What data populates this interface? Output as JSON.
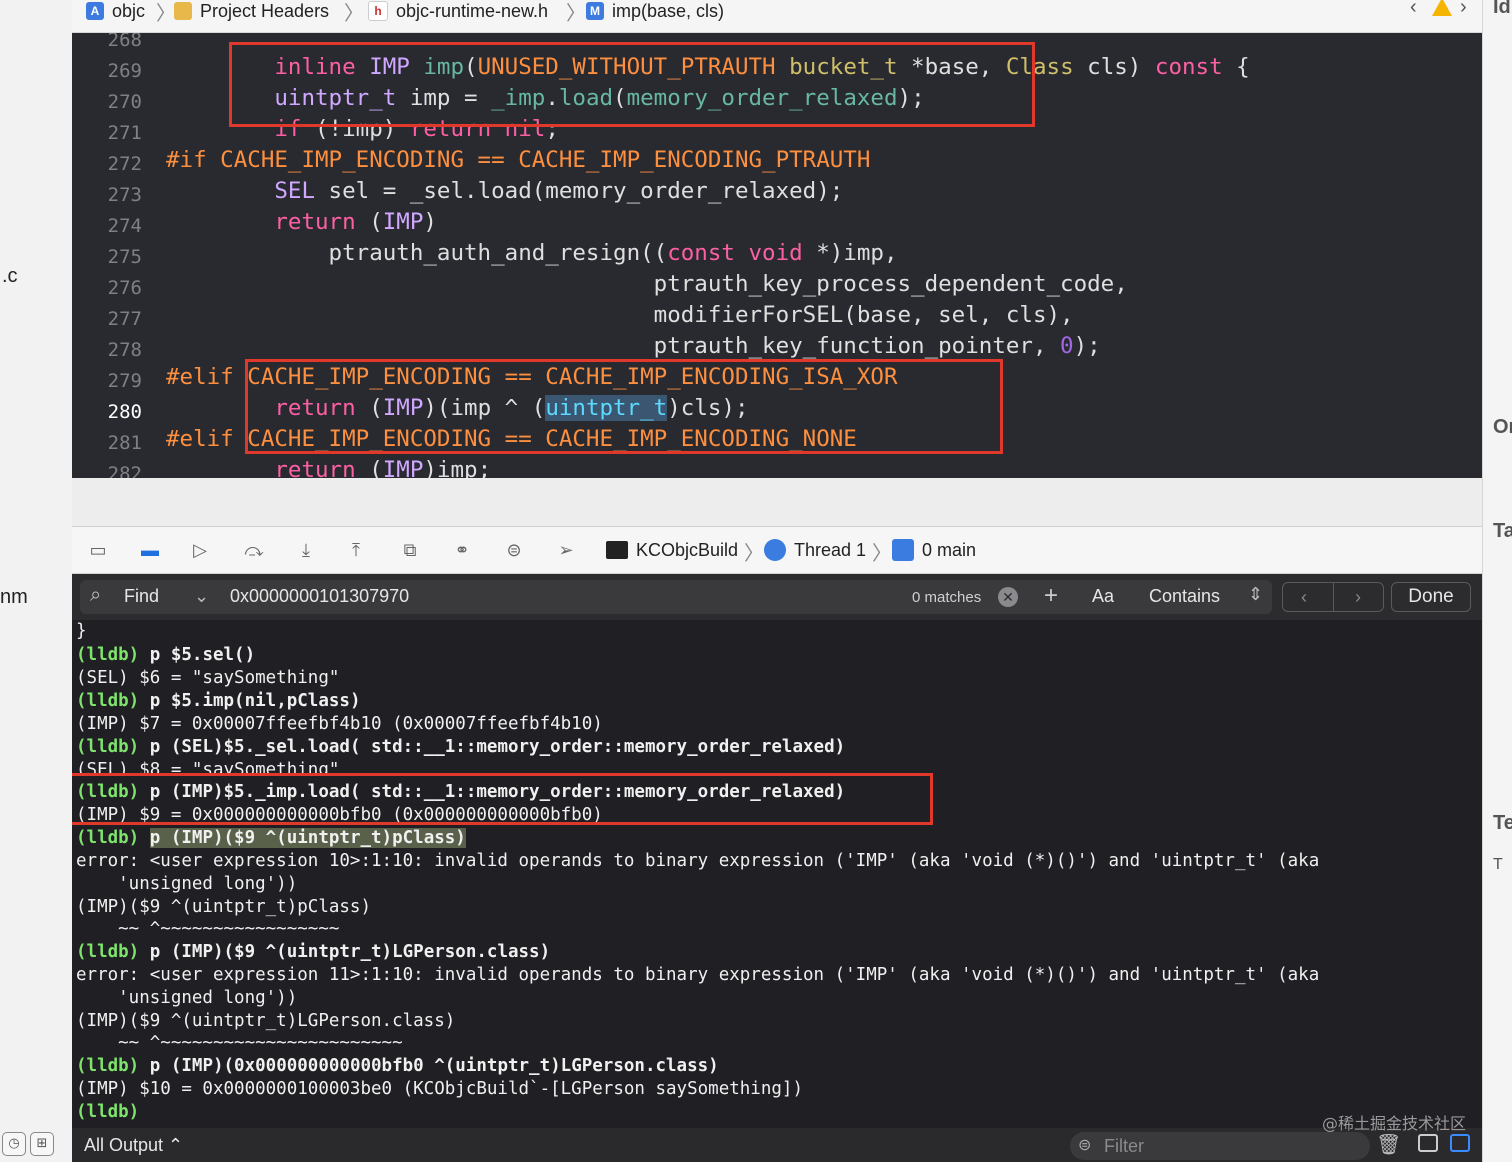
{
  "sidebar_fragments": [
    ".c",
    "nm"
  ],
  "inspector_fragments": [
    "Id",
    "Or",
    "Ta",
    "Te",
    "T"
  ],
  "breadcrumb": {
    "items": [
      {
        "label": "objc",
        "icon": "project-icon"
      },
      {
        "label": "Project Headers",
        "icon": "folder-icon"
      },
      {
        "label": "objc-runtime-new.h",
        "icon": "header-file-icon"
      },
      {
        "label": "imp(base, cls)",
        "icon": "method-icon"
      }
    ]
  },
  "editor": {
    "line_numbers": [
      "268",
      "269",
      "270",
      "271",
      "272",
      "273",
      "274",
      "275",
      "276",
      "277",
      "278",
      "279",
      "280",
      "281",
      "282"
    ],
    "current_line": "280"
  },
  "debug_bar": {
    "target": "KCObjcBuild",
    "thread": "Thread 1",
    "frame": "0 main"
  },
  "find_bar": {
    "mode": "Find",
    "query": "0x0000000101307970",
    "matches": "0 matches",
    "case_label": "Aa",
    "match_mode": "Contains",
    "done_label": "Done"
  },
  "console_lines": [
    "}",
    "(lldb) p $5.sel()",
    "(SEL) $6 = \"saySomething\"",
    "(lldb) p $5.imp(nil,pClass)",
    "(IMP) $7 = 0x00007ffeefbf4b10 (0x00007ffeefbf4b10)",
    "(lldb) p (SEL)$5._sel.load( std::__1::memory_order::memory_order_relaxed)",
    "(SEL) $8 = \"saySomething\"",
    "(lldb) p (IMP)$5._imp.load( std::__1::memory_order::memory_order_relaxed)",
    "(IMP) $9 = 0x000000000000bfb0 (0x000000000000bfb0)",
    "(lldb) p (IMP)($9 ^(uintptr_t)pClass)",
    "error: <user expression 10>:1:10: invalid operands to binary expression ('IMP' (aka 'void (*)()') and 'uintptr_t' (aka",
    "    'unsigned long'))",
    "(IMP)($9 ^(uintptr_t)pClass)",
    "    ~~ ^~~~~~~~~~~~~~~~~~",
    "(lldb) p (IMP)($9 ^(uintptr_t)LGPerson.class)",
    "error: <user expression 11>:1:10: invalid operands to binary expression ('IMP' (aka 'void (*)()') and 'uintptr_t' (aka",
    "    'unsigned long'))",
    "(IMP)($9 ^(uintptr_t)LGPerson.class)",
    "    ~~ ^~~~~~~~~~~~~~~~~~~~~~~~",
    "(lldb) p (IMP)(0x000000000000bfb0 ^(uintptr_t)LGPerson.class)",
    "(IMP) $10 = 0x0000000100003be0 (KCObjcBuild`-[LGPerson saySomething])",
    "(lldb)"
  ],
  "status_bar": {
    "output_filter": "All Output ⌃",
    "filter_placeholder": "Filter",
    "watermark": "@稀土掘金技术社区"
  },
  "colors": {
    "editor_bg": "#292a30",
    "console_bg": "#1f1f24",
    "keyword": "#fc5fa3",
    "preprocessor": "#fd8f3f",
    "lldb_prompt": "#7de36a",
    "annotation_box": "#e0392b"
  }
}
